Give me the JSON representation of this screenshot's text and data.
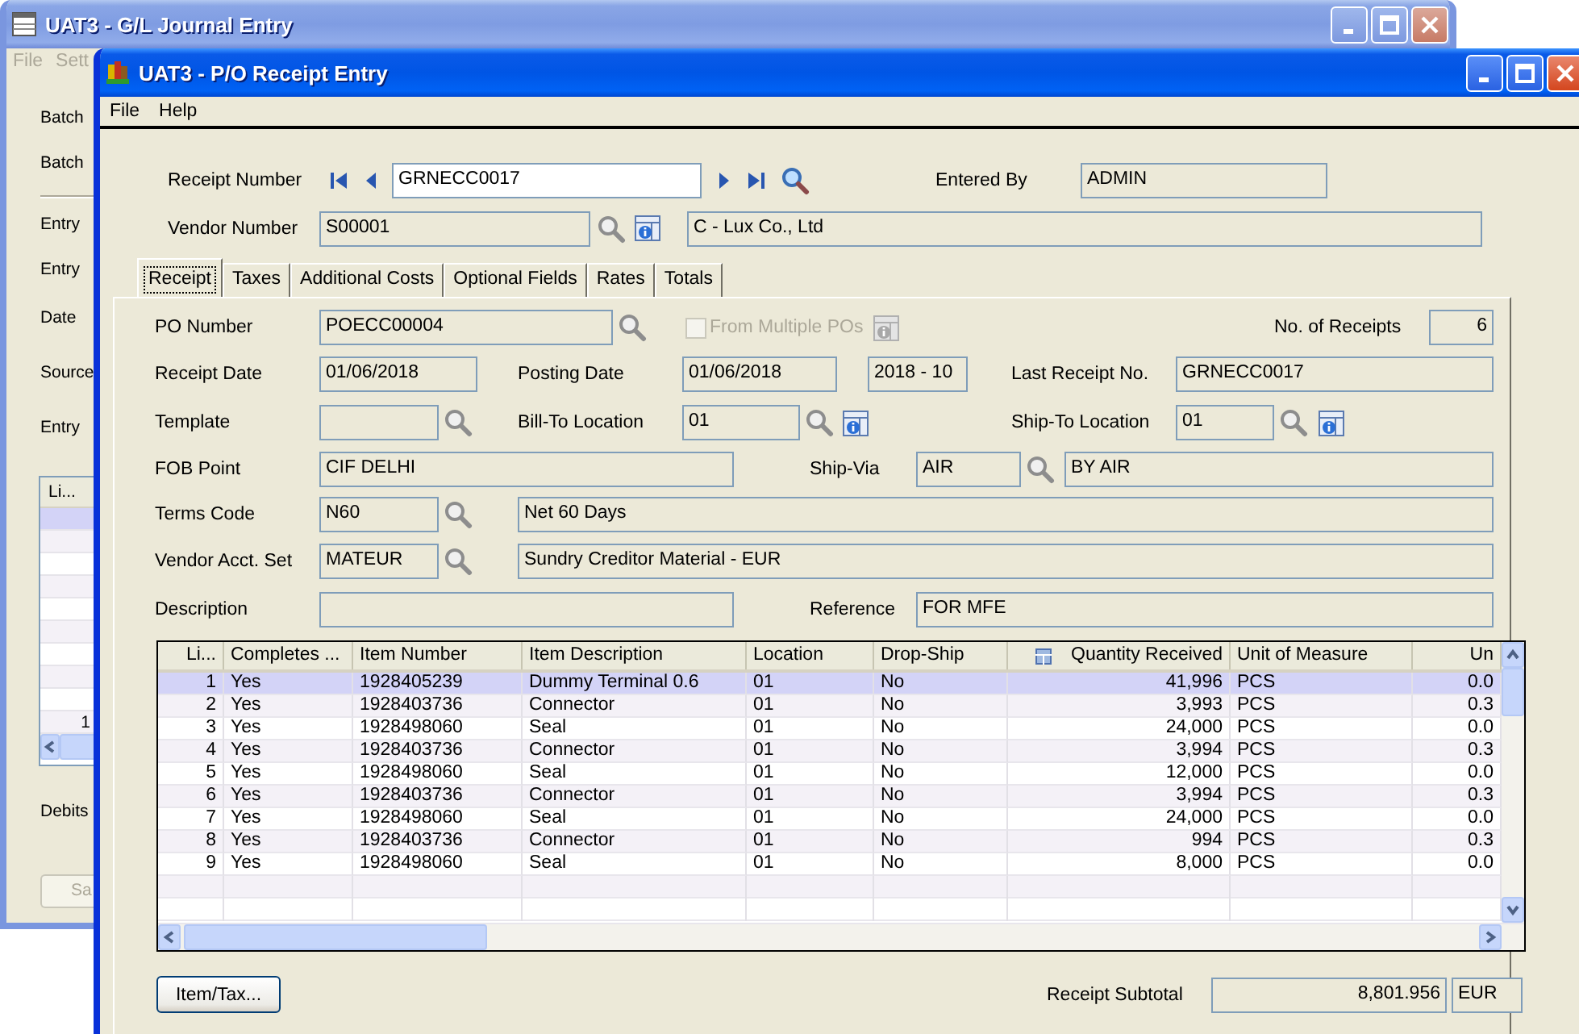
{
  "background_window": {
    "title": "UAT3 - G/L Journal Entry",
    "menu": [
      "File",
      "Sett"
    ],
    "labels": [
      "Batch",
      "Batch",
      "Entry",
      "Entry",
      "Date",
      "Source",
      "Entry"
    ],
    "table": {
      "columns": [
        "Li..."
      ],
      "rows": [
        {
          "selected": true
        },
        {
          "selected": false
        },
        {
          "selected": false
        },
        {
          "selected": false
        },
        {
          "selected": false
        },
        {
          "selected": false
        },
        {
          "selected": false
        },
        {
          "selected": false
        },
        {
          "selected": false
        },
        {
          "line": "1",
          "selected": false
        }
      ]
    },
    "totals_label": "Debits",
    "button": "Sa"
  },
  "window": {
    "title": "UAT3 - P/O Receipt Entry",
    "menu": [
      "File",
      "Help"
    ]
  },
  "header": {
    "receipt_number": {
      "label": "Receipt Number",
      "value": "GRNECC0017"
    },
    "entered_by": {
      "label": "Entered By",
      "value": "ADMIN"
    },
    "vendor_number": {
      "label": "Vendor Number",
      "value": "S00001",
      "name": "C - Lux Co., Ltd"
    }
  },
  "tabs": [
    {
      "label": "Receipt",
      "selected": true
    },
    {
      "label": "Taxes",
      "selected": false
    },
    {
      "label": "Additional Costs",
      "selected": false
    },
    {
      "label": "Optional Fields",
      "selected": false
    },
    {
      "label": "Rates",
      "selected": false
    },
    {
      "label": "Totals",
      "selected": false
    }
  ],
  "receipt": {
    "po_number": {
      "label": "PO Number",
      "value": "POECC00004"
    },
    "from_multiple_pos": {
      "label": "From Multiple POs",
      "checked": false,
      "disabled": true
    },
    "no_of_receipts": {
      "label": "No. of Receipts",
      "value": "6"
    },
    "receipt_date": {
      "label": "Receipt Date",
      "value": "01/06/2018"
    },
    "posting_date": {
      "label": "Posting Date",
      "value": "01/06/2018",
      "period": "2018 - 10"
    },
    "last_receipt_no": {
      "label": "Last Receipt No.",
      "value": "GRNECC0017"
    },
    "template": {
      "label": "Template"
    },
    "bill_to_location": {
      "label": "Bill-To Location",
      "value": "01"
    },
    "ship_to_location": {
      "label": "Ship-To Location",
      "value": "01"
    },
    "fob_point": {
      "label": "FOB Point",
      "value": "CIF DELHI"
    },
    "ship_via": {
      "label": "Ship-Via",
      "value": "AIR",
      "description": "BY AIR"
    },
    "terms_code": {
      "label": "Terms Code",
      "value": "N60",
      "description": "Net 60 Days"
    },
    "vendor_acct_set": {
      "label": "Vendor Acct. Set",
      "value": "MATEUR",
      "description": "Sundry Creditor Material - EUR"
    },
    "description": {
      "label": "Description"
    },
    "reference": {
      "label": "Reference",
      "value": "FOR MFE"
    }
  },
  "lines": {
    "columns": [
      "Li...",
      "Completes ...",
      "Item Number",
      "Item Description",
      "Location",
      "Drop-Ship",
      "Quantity Received",
      "Unit of Measure",
      "Un"
    ],
    "rows": [
      {
        "cells": [
          "1",
          "Yes",
          "1928405239",
          "Dummy Terminal 0.6",
          "01",
          "No",
          "41,996",
          "PCS",
          "0.0"
        ],
        "selected": true
      },
      {
        "cells": [
          "2",
          "Yes",
          "1928403736",
          "Connector",
          "01",
          "No",
          "3,993",
          "PCS",
          "0.3"
        ],
        "selected": false
      },
      {
        "cells": [
          "3",
          "Yes",
          "1928498060",
          "Seal",
          "01",
          "No",
          "24,000",
          "PCS",
          "0.0"
        ],
        "selected": false
      },
      {
        "cells": [
          "4",
          "Yes",
          "1928403736",
          "Connector",
          "01",
          "No",
          "3,994",
          "PCS",
          "0.3"
        ],
        "selected": false
      },
      {
        "cells": [
          "5",
          "Yes",
          "1928498060",
          "Seal",
          "01",
          "No",
          "12,000",
          "PCS",
          "0.0"
        ],
        "selected": false
      },
      {
        "cells": [
          "6",
          "Yes",
          "1928403736",
          "Connector",
          "01",
          "No",
          "3,994",
          "PCS",
          "0.3"
        ],
        "selected": false
      },
      {
        "cells": [
          "7",
          "Yes",
          "1928498060",
          "Seal",
          "01",
          "No",
          "24,000",
          "PCS",
          "0.0"
        ],
        "selected": false
      },
      {
        "cells": [
          "8",
          "Yes",
          "1928403736",
          "Connector",
          "01",
          "No",
          "994",
          "PCS",
          "0.3"
        ],
        "selected": false
      },
      {
        "cells": [
          "9",
          "Yes",
          "1928498060",
          "Seal",
          "01",
          "No",
          "8,000",
          "PCS",
          "0.0"
        ],
        "selected": false
      }
    ]
  },
  "footer": {
    "button": "Item/Tax...",
    "subtotal_label": "Receipt Subtotal",
    "subtotal": "8,801.956",
    "currency": "EUR"
  }
}
